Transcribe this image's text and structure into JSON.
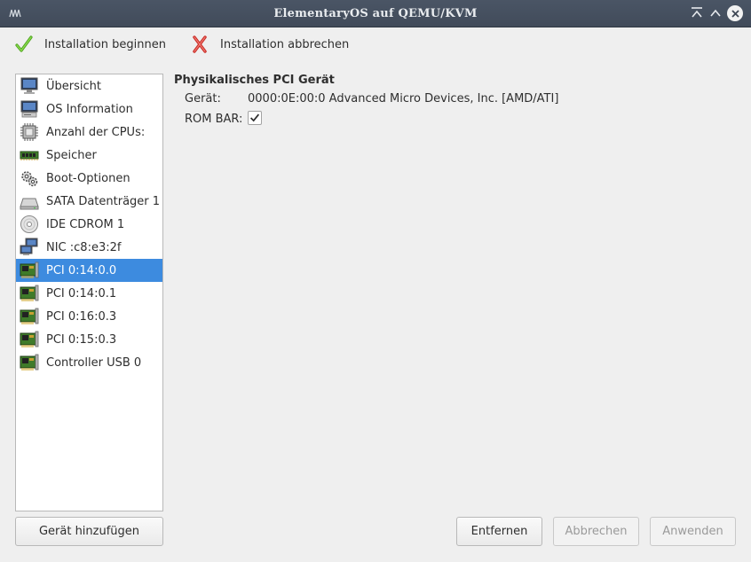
{
  "window": {
    "title": "ElementaryOS auf QEMU/KVM"
  },
  "toolbar": {
    "begin_label": "Installation beginnen",
    "cancel_label": "Installation abbrechen"
  },
  "sidebar": {
    "items": [
      {
        "label": "Übersicht",
        "icon": "monitor-icon"
      },
      {
        "label": "OS Information",
        "icon": "computer-icon"
      },
      {
        "label": "Anzahl der CPUs:",
        "icon": "cpu-icon"
      },
      {
        "label": "Speicher",
        "icon": "memory-icon"
      },
      {
        "label": "Boot-Optionen",
        "icon": "gears-icon"
      },
      {
        "label": "SATA Datenträger 1",
        "icon": "harddisk-icon"
      },
      {
        "label": "IDE CDROM 1",
        "icon": "cdrom-icon"
      },
      {
        "label": "NIC :c8:e3:2f",
        "icon": "network-icon"
      },
      {
        "label": "PCI 0:14:0.0",
        "icon": "pci-card-icon",
        "selected": true
      },
      {
        "label": "PCI 0:14:0.1",
        "icon": "pci-card-icon"
      },
      {
        "label": "PCI 0:16:0.3",
        "icon": "pci-card-icon"
      },
      {
        "label": "PCI 0:15:0.3",
        "icon": "pci-card-icon"
      },
      {
        "label": "Controller USB 0",
        "icon": "pci-card-icon"
      }
    ]
  },
  "detail": {
    "title": "Physikalisches PCI Gerät",
    "device_label": "Gerät:",
    "device_value": "0000:0E:00:0 Advanced Micro Devices, Inc. [AMD/ATI]",
    "rombar_label": "ROM BAR:",
    "rombar_checked": true
  },
  "buttons": {
    "add": "Gerät hinzufügen",
    "remove": "Entfernen",
    "abort": "Abbrechen",
    "apply": "Anwenden"
  },
  "colors": {
    "titlebar": "#444e5d",
    "selection": "#3d8bdf",
    "check_green": "#5cb82a",
    "cancel_red": "#d9322d"
  }
}
